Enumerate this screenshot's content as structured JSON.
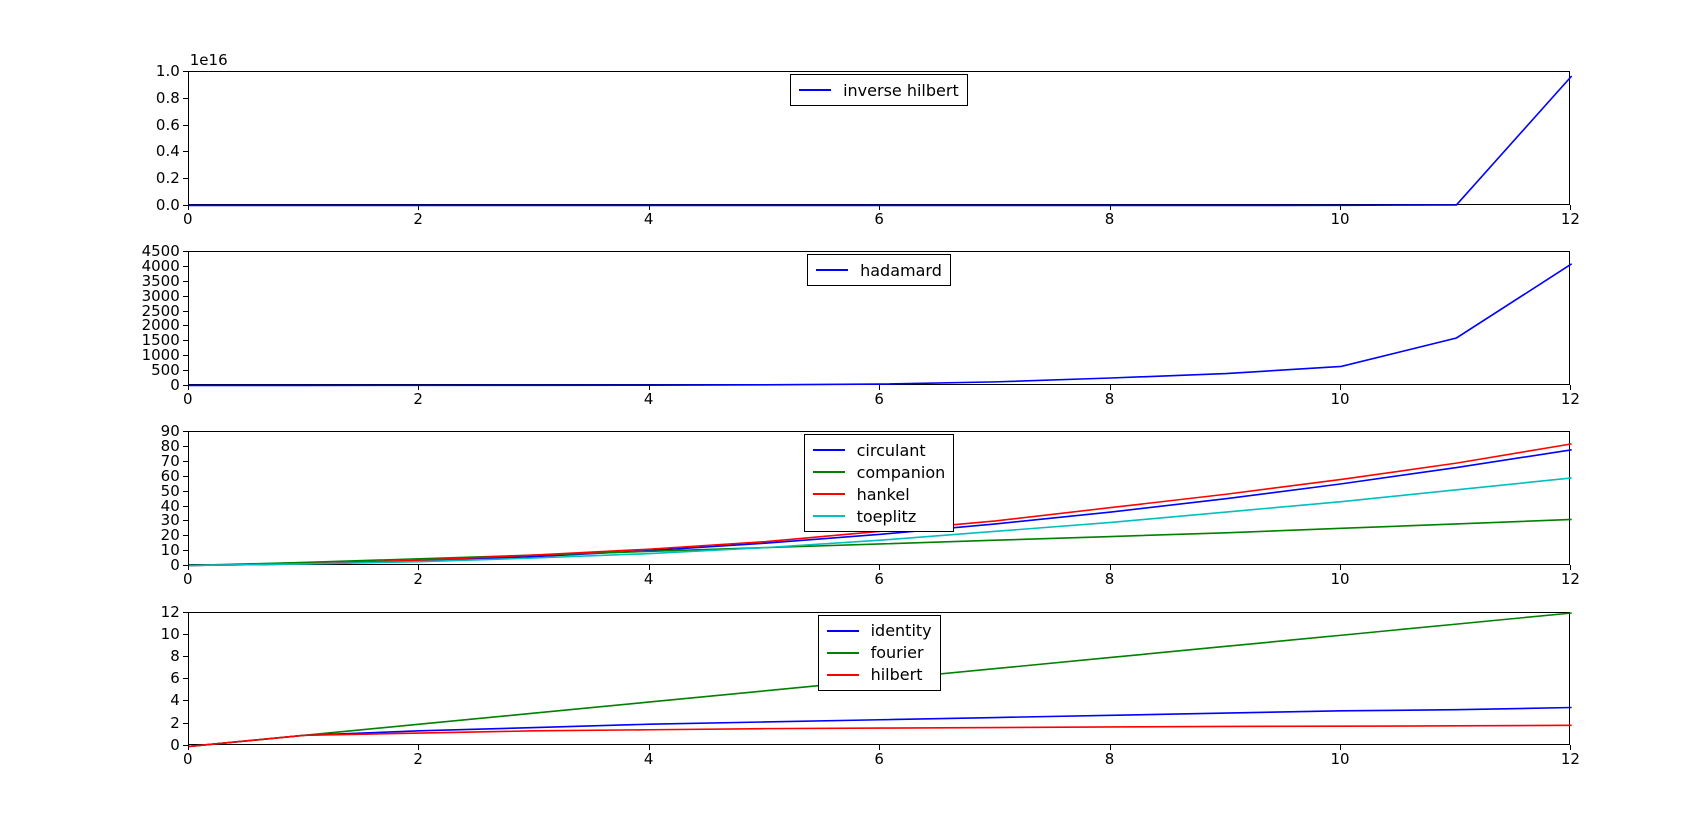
{
  "chart_data": [
    {
      "type": "line",
      "x": [
        0,
        1,
        2,
        3,
        4,
        5,
        6,
        7,
        8,
        9,
        10,
        11,
        12
      ],
      "xlim": [
        0,
        12
      ],
      "ylim": [
        0,
        1e+16
      ],
      "xticks": [
        0,
        2,
        4,
        6,
        8,
        10,
        12
      ],
      "yticks": [
        0,
        2000000000000000.0,
        4000000000000000.0,
        6000000000000000.0,
        8000000000000000.0,
        1e+16
      ],
      "ytick_labels": [
        "0.0",
        "0.2",
        "0.4",
        "0.6",
        "0.8",
        "1.0"
      ],
      "ylabel_exp": "1e16",
      "legend_pos": "upper center",
      "series": [
        {
          "name": "inverse hilbert",
          "color": "#0000ff",
          "values": [
            0,
            1,
            10,
            200,
            7000,
            200000,
            6000000,
            150000000,
            5000000000.0,
            150000000000.0,
            4000000000000.0,
            40000000000000.0,
            9700000000000000.0
          ]
        }
      ]
    },
    {
      "type": "line",
      "x": [
        0,
        1,
        2,
        3,
        4,
        5,
        6,
        7,
        8,
        9,
        10,
        11,
        12
      ],
      "xlim": [
        0,
        12
      ],
      "ylim": [
        0,
        4500
      ],
      "xticks": [
        0,
        2,
        4,
        6,
        8,
        10,
        12
      ],
      "yticks": [
        0,
        500,
        1000,
        1500,
        2000,
        2500,
        3000,
        3500,
        4000,
        4500
      ],
      "ytick_labels": [
        "0",
        "500",
        "1000",
        "1500",
        "2000",
        "2500",
        "3000",
        "3500",
        "4000",
        "4500"
      ],
      "legend_pos": "upper center",
      "series": [
        {
          "name": "hadamard",
          "color": "#0000ff",
          "values": [
            0,
            1,
            2,
            4,
            8,
            20,
            45,
            120,
            250,
            400,
            640,
            1600,
            4100
          ]
        }
      ]
    },
    {
      "type": "line",
      "x": [
        0,
        1,
        2,
        3,
        4,
        5,
        6,
        7,
        8,
        9,
        10,
        11,
        12
      ],
      "xlim": [
        0,
        12
      ],
      "ylim": [
        0,
        90
      ],
      "xticks": [
        0,
        2,
        4,
        6,
        8,
        10,
        12
      ],
      "yticks": [
        0,
        10,
        20,
        30,
        40,
        50,
        60,
        70,
        80,
        90
      ],
      "ytick_labels": [
        "0",
        "10",
        "20",
        "30",
        "40",
        "50",
        "60",
        "70",
        "80",
        "90"
      ],
      "legend_pos": "upper center",
      "series": [
        {
          "name": "circulant",
          "color": "#0000ff",
          "values": [
            0,
            1,
            3,
            6,
            10,
            15,
            21,
            28,
            36,
            45,
            55,
            66,
            78
          ]
        },
        {
          "name": "companion",
          "color": "#008000",
          "values": [
            0,
            2,
            4.5,
            7,
            9.5,
            12,
            14.5,
            17,
            19.5,
            22,
            25,
            28,
            31
          ]
        },
        {
          "name": "hankel",
          "color": "#ff0000",
          "values": [
            0,
            1,
            3.5,
            7,
            11,
            16,
            23,
            30,
            39,
            48,
            58,
            69,
            82
          ]
        },
        {
          "name": "toeplitz",
          "color": "#00bfbf",
          "values": [
            0,
            1,
            2.5,
            5,
            8,
            12,
            17,
            23,
            29,
            36,
            43,
            51,
            59
          ]
        }
      ]
    },
    {
      "type": "line",
      "x": [
        0,
        1,
        2,
        3,
        4,
        5,
        6,
        7,
        8,
        9,
        10,
        11,
        12
      ],
      "xlim": [
        0,
        12
      ],
      "ylim": [
        0,
        12
      ],
      "xticks": [
        0,
        2,
        4,
        6,
        8,
        10,
        12
      ],
      "yticks": [
        0,
        2,
        4,
        6,
        8,
        10,
        12
      ],
      "ytick_labels": [
        "0",
        "2",
        "4",
        "6",
        "8",
        "10",
        "12"
      ],
      "legend_pos": "upper center",
      "series": [
        {
          "name": "identity",
          "color": "#0000ff",
          "values": [
            0,
            1.0,
            1.4,
            1.7,
            2.0,
            2.2,
            2.4,
            2.6,
            2.8,
            3.0,
            3.2,
            3.3,
            3.5
          ]
        },
        {
          "name": "fourier",
          "color": "#008000",
          "values": [
            0,
            1,
            2,
            3,
            4,
            5,
            6,
            7,
            8,
            9,
            10,
            11,
            12
          ]
        },
        {
          "name": "hilbert",
          "color": "#ff0000",
          "values": [
            0,
            1.0,
            1.2,
            1.4,
            1.5,
            1.6,
            1.65,
            1.7,
            1.75,
            1.8,
            1.82,
            1.85,
            1.9
          ]
        }
      ]
    }
  ]
}
